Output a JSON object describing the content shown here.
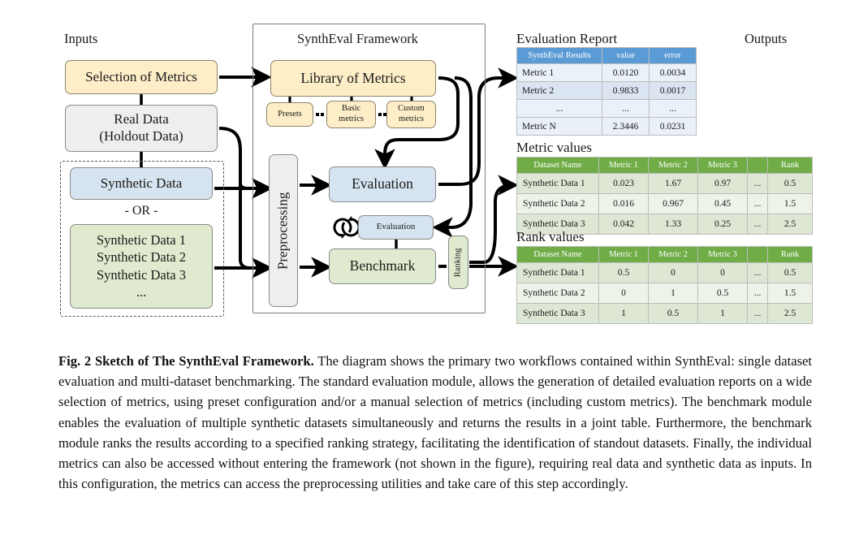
{
  "figure": {
    "inputs_label": "Inputs",
    "outputs_label": "Outputs",
    "framework_title": "SynthEval Framework",
    "nodes": {
      "selection_of_metrics": "Selection of Metrics",
      "real_data_line1": "Real Data",
      "real_data_line2": "(Holdout Data)",
      "synthetic_data": "Synthetic Data",
      "or_separator": "- OR -",
      "synthetic_list": [
        "Synthetic Data 1",
        "Synthetic Data 2",
        "Synthetic Data 3",
        "..."
      ],
      "library_of_metrics": "Library of Metrics",
      "presets": "Presets",
      "basic_metrics_line1": "Basic",
      "basic_metrics_line2": "metrics",
      "custom_metrics_line1": "Custom",
      "custom_metrics_line2": "metrics",
      "preprocessing": "Preprocessing",
      "evaluation": "Evaluation",
      "evaluation_small": "Evaluation",
      "benchmark": "Benchmark",
      "ranking": "Ranking"
    },
    "colors": {
      "yellow_fill": "#fdeec8",
      "grey_fill": "#eeeeee",
      "blue_fill": "#d6e3f0",
      "green_fill": "#dfeace",
      "table_blue_header": "#5b9bd5",
      "table_green_header": "#70ad47",
      "table_blue_row": "#eaf0f8",
      "table_blue_row_alt": "#dbe5f1",
      "table_green_row": "#dde7d3",
      "table_green_row_alt": "#eef3e9"
    }
  },
  "tables": {
    "report": {
      "title": "Evaluation Report",
      "headers": [
        "SynthEval Results",
        "value",
        "error"
      ],
      "rows": [
        [
          "Metric 1",
          "0.0120",
          "0.0034"
        ],
        [
          "Metric 2",
          "0.9833",
          "0.0017"
        ],
        [
          "...",
          "...",
          "..."
        ],
        [
          "Metric N",
          "2.3446",
          "0.0231"
        ]
      ]
    },
    "metric_values": {
      "title": "Metric values",
      "headers": [
        "Dataset Name",
        "Metric 1",
        "Metric 2",
        "Metric 3",
        "",
        "Rank"
      ],
      "rows": [
        [
          "Synthetic Data 1",
          "0.023",
          "1.67",
          "0.97",
          "...",
          "0.5"
        ],
        [
          "Synthetic Data 2",
          "0.016",
          "0.967",
          "0.45",
          "...",
          "1.5"
        ],
        [
          "Synthetic Data 3",
          "0.042",
          "1.33",
          "0.25",
          "...",
          "2.5"
        ]
      ]
    },
    "rank_values": {
      "title": "Rank values",
      "headers": [
        "Dataset Name",
        "Metric 1",
        "Metric 2",
        "Metric 3",
        "",
        "Rank"
      ],
      "rows": [
        [
          "Synthetic Data 1",
          "0.5",
          "0",
          "0",
          "...",
          "0.5"
        ],
        [
          "Synthetic Data 2",
          "0",
          "1",
          "0.5",
          "...",
          "1.5"
        ],
        [
          "Synthetic Data 3",
          "1",
          "0.5",
          "1",
          "...",
          "2.5"
        ]
      ]
    }
  },
  "caption": {
    "lead": "Fig. 2 Sketch of The SynthEval Framework.",
    "body": " The diagram shows the primary two workflows contained within SynthEval: single dataset evaluation and multi-dataset benchmarking. The standard evaluation module, allows the generation of detailed evaluation reports on a wide selection of metrics, using preset configuration and/or a manual selection of metrics (including custom metrics). The benchmark module enables the evaluation of multiple synthetic datasets simultaneously and returns the results in a joint table. Furthermore, the benchmark module ranks the results according to a specified ranking strategy, facilitating the identification of standout datasets. Finally, the individual metrics can also be accessed without entering the framework (not shown in the figure), requiring real data and synthetic data as inputs. In this configuration, the metrics can access the preprocessing utilities and take care of this step accordingly."
  }
}
